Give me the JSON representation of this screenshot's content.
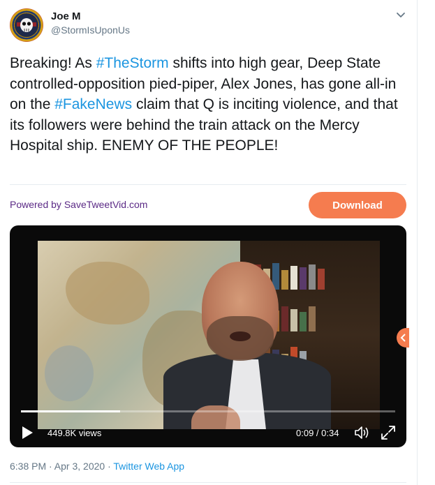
{
  "author": {
    "name": "Joe M",
    "handle": "@StormIsUponUs"
  },
  "tweet": {
    "text_parts": [
      {
        "text": "Breaking! As ",
        "type": "text"
      },
      {
        "text": "#TheStorm",
        "type": "hashtag"
      },
      {
        "text": " shifts into high gear, Deep State controlled-opposition pied-piper, Alex Jones, has gone all-in on the ",
        "type": "text"
      },
      {
        "text": "#FakeNews",
        "type": "hashtag"
      },
      {
        "text": " claim that Q is inciting violence, and that its followers were behind the train attack on the Mercy Hospital ship. ENEMY OF THE PEOPLE!",
        "type": "text"
      }
    ]
  },
  "plugin": {
    "powered_by": "Powered by SaveTweetVid.com",
    "download_label": "Download"
  },
  "video": {
    "views": "449.8K views",
    "time": "0:09 / 0:34",
    "progress": 0.265
  },
  "meta": {
    "timestamp": "6:38 PM · Apr 3, 2020 · ",
    "source": "Twitter Web App"
  },
  "colors": {
    "link": "#1b95e0",
    "download": "#f57c4f",
    "muted": "#657786"
  },
  "icons": [
    "caret-down-icon",
    "play-icon",
    "volume-icon",
    "fullscreen-icon",
    "avatar-skull-logo"
  ]
}
